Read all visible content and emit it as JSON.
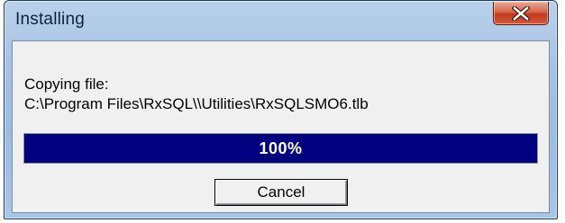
{
  "window": {
    "title": "Installing"
  },
  "titlebar": {
    "close_icon": "close-x-icon"
  },
  "message": {
    "line1": "Copying file:",
    "line2": "C:\\Program Files\\RxSQL\\\\Utilities\\RxSQLSMO6.tlb"
  },
  "progress": {
    "value": 1.0,
    "label": "100%",
    "fill_color": "#000080"
  },
  "buttons": {
    "cancel_label": "Cancel"
  }
}
